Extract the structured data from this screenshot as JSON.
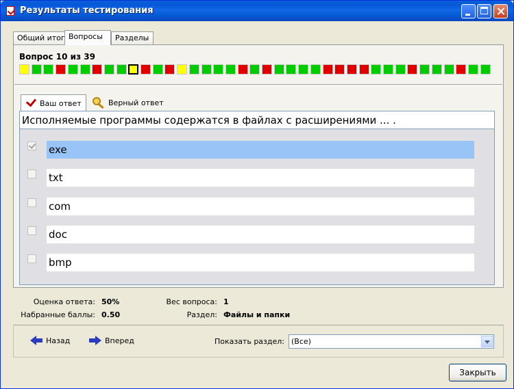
{
  "window": {
    "title": "Результаты тестирования"
  },
  "tabs": [
    "Общий итог",
    "Вопросы",
    "Разделы"
  ],
  "question": {
    "header": "Вопрос 10 из 39",
    "current_index": 10,
    "statuses": [
      "yellow",
      "green",
      "green",
      "red",
      "green",
      "green",
      "red",
      "green",
      "green",
      "yellow",
      "red",
      "green",
      "red",
      "yellow",
      "green",
      "green",
      "green",
      "green",
      "red",
      "green",
      "red",
      "green",
      "green",
      "green",
      "green",
      "red",
      "red",
      "red",
      "red",
      "green",
      "green",
      "green",
      "red",
      "green",
      "green",
      "green",
      "red",
      "green",
      "green"
    ]
  },
  "colors": {
    "green": "#00cc00",
    "red": "#e00000",
    "yellow": "#ffff00"
  },
  "subtabs": {
    "your_answer": "Ваш ответ",
    "correct_answer": "Верный ответ"
  },
  "question_text": "Исполняемые программы содержатся в файлах с расширениями ... .",
  "answers": [
    {
      "text": "exe",
      "checked": true,
      "highlighted": true
    },
    {
      "text": "txt",
      "checked": false,
      "highlighted": false
    },
    {
      "text": "com",
      "checked": false,
      "highlighted": false
    },
    {
      "text": "doc",
      "checked": false,
      "highlighted": false
    },
    {
      "text": "bmp",
      "checked": false,
      "highlighted": false
    }
  ],
  "info": {
    "score_label": "Оценка ответа:",
    "score_value": "50%",
    "points_label": "Набранные баллы:",
    "points_value": "0.50",
    "weight_label": "Вес вопроса:",
    "weight_value": "1",
    "section_label": "Раздел:",
    "section_value": "Файлы и папки"
  },
  "nav": {
    "back": "Назад",
    "forward": "Вперед",
    "show_section_label": "Показать раздел:",
    "section_select": "(Все)"
  },
  "close_button": "Закрыть"
}
